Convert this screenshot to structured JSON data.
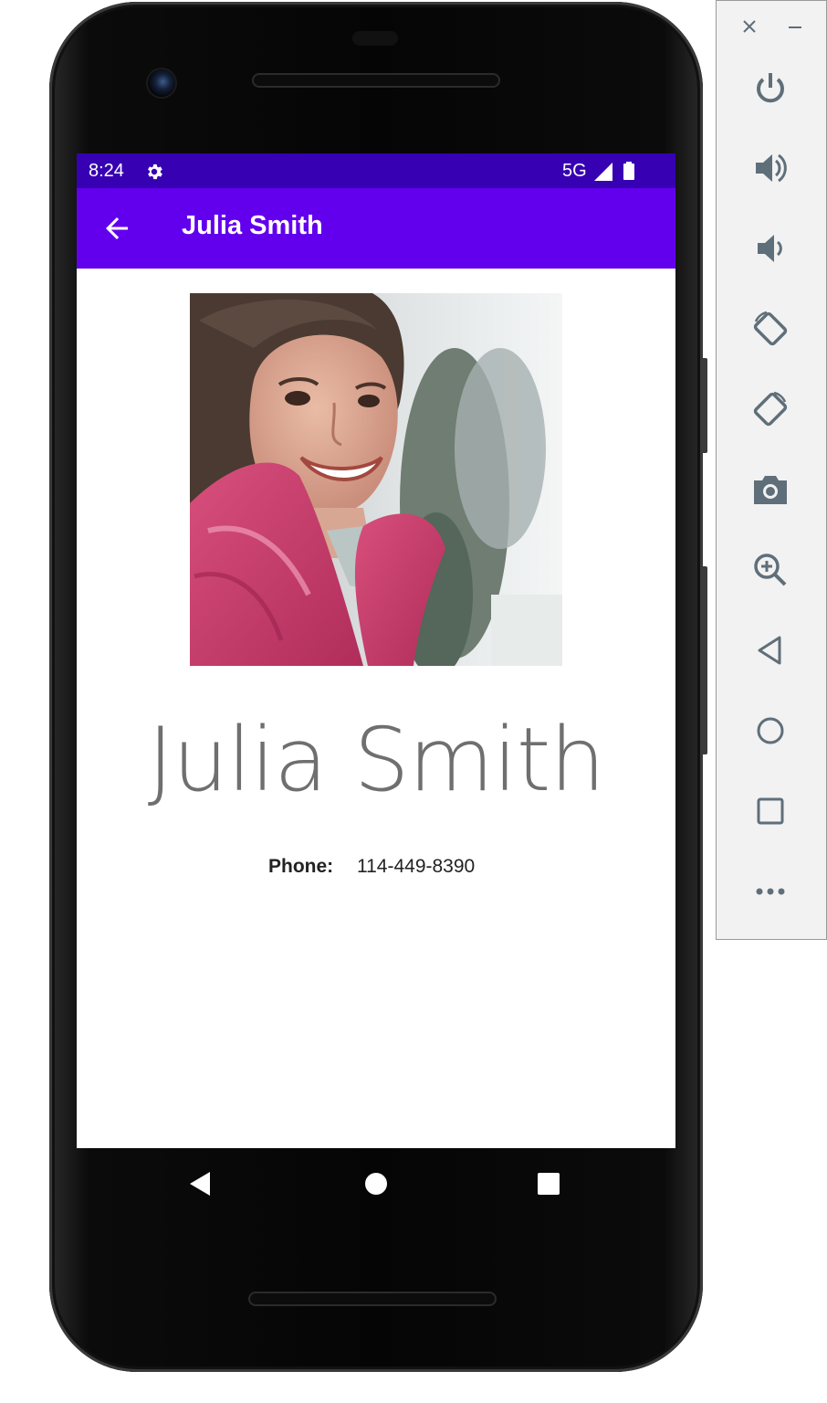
{
  "status_bar": {
    "time": "8:24",
    "network": "5G",
    "icons": [
      "settings-icon",
      "signal-icon",
      "battery-icon"
    ],
    "color": "#3700b3"
  },
  "app_bar": {
    "title": "Julia Smith",
    "back_icon": "arrow-back-icon",
    "color": "#6200ee"
  },
  "contact": {
    "photo_description": "contact-photo",
    "name": "Julia Smith",
    "phone_label": "Phone:",
    "phone_value": "114-449-8390"
  },
  "nav_bar": {
    "icons": [
      "nav-back-icon",
      "nav-home-icon",
      "nav-recents-icon"
    ]
  },
  "emulator_toolbar": {
    "window_controls": [
      "close-icon",
      "minimize-icon"
    ],
    "buttons": [
      "power-icon",
      "volume-up-icon",
      "volume-down-icon",
      "rotate-left-icon",
      "rotate-right-icon",
      "screenshot-camera-icon",
      "zoom-icon",
      "back-triangle-icon",
      "home-circle-icon",
      "overview-square-icon",
      "more-icon"
    ],
    "icon_color": "#5f6f7a"
  }
}
